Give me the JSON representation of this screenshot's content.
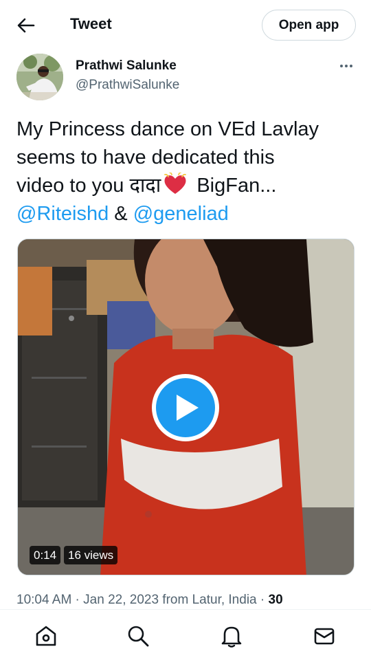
{
  "header": {
    "title": "Tweet",
    "open_app_label": "Open app"
  },
  "author": {
    "display_name": "Prathwi Salunke",
    "handle": "@PrathwiSalunke"
  },
  "tweet": {
    "line1": "My Princess dance on VEd Lavlay",
    "line2": "seems to have dedicated this",
    "line3_before": "video to you दादा",
    "line3_after": " BigFan...",
    "mention1": "@Riteishd",
    "amp": " & ",
    "mention2": "@geneliad"
  },
  "media": {
    "duration": "0:14",
    "views": "16 views"
  },
  "meta": {
    "info": "10:04 AM · Jan 22, 2023 from Latur, India · ",
    "count": "30"
  },
  "icons": {
    "back": "back-arrow-icon",
    "more": "more-horizontal-icon",
    "play": "play-icon",
    "heart": "heart-emoji-icon",
    "home": "home-icon",
    "search": "search-icon",
    "notifications": "bell-icon",
    "messages": "envelope-icon"
  },
  "colors": {
    "accent": "#1d9bf0",
    "text_primary": "#0f1419",
    "text_secondary": "#536471",
    "border": "#cfd9de"
  }
}
